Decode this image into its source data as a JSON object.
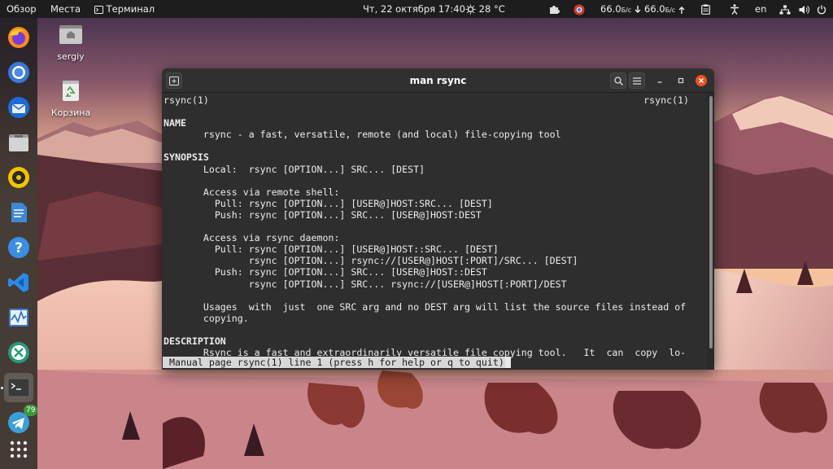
{
  "topbar": {
    "activities": "Обзор",
    "places": "Места",
    "app_name": "Терминал",
    "clock": "Чт, 22 октября  17:40",
    "weather": "28 °C",
    "net_down": "66.0",
    "net_down_unit": "Б/с",
    "net_up": "66.0",
    "net_up_unit": "Б/с",
    "language": "en"
  },
  "dock": {
    "notification_count": "79",
    "items": [
      {
        "icon": "firefox-icon"
      },
      {
        "icon": "chromium-icon"
      },
      {
        "icon": "thunderbird-icon"
      },
      {
        "icon": "files-icon"
      },
      {
        "icon": "rhythmbox-icon"
      },
      {
        "icon": "writer-icon"
      },
      {
        "icon": "help-icon"
      },
      {
        "icon": "vscode-icon"
      },
      {
        "icon": "system-monitor-icon"
      },
      {
        "icon": "remote-desktop-icon"
      },
      {
        "icon": "terminal-icon"
      },
      {
        "icon": "telegram-icon"
      },
      {
        "icon": "show-apps-icon"
      }
    ]
  },
  "desktop": {
    "home_label": "sergiy",
    "trash_label": "Корзина"
  },
  "terminal": {
    "title": "man rsync",
    "header_left": "rsync(1)",
    "header_right": "rsync(1)",
    "lines": [
      "",
      "NAME",
      "       rsync - a fast, versatile, remote (and local) file-copying tool",
      "",
      "SYNOPSIS",
      "       Local:  rsync [OPTION...] SRC... [DEST]",
      "",
      "       Access via remote shell:",
      "         Pull: rsync [OPTION...] [USER@]HOST:SRC... [DEST]",
      "         Push: rsync [OPTION...] SRC... [USER@]HOST:DEST",
      "",
      "       Access via rsync daemon:",
      "         Pull: rsync [OPTION...] [USER@]HOST::SRC... [DEST]",
      "               rsync [OPTION...] rsync://[USER@]HOST[:PORT]/SRC... [DEST]",
      "         Push: rsync [OPTION...] SRC... [USER@]HOST::DEST",
      "               rsync [OPTION...] SRC... rsync://[USER@]HOST[:PORT]/DEST",
      "",
      "       Usages  with  just  one SRC arg and no DEST arg will list the source files instead of",
      "       copying.",
      "",
      "DESCRIPTION",
      "       Rsync is a fast and extraordinarily versatile file copying tool.   It  can  copy  lo-"
    ],
    "bold_lines": [
      1,
      4,
      20
    ],
    "status": " Manual page rsync(1) line 1 (press h for help or q to quit)"
  }
}
